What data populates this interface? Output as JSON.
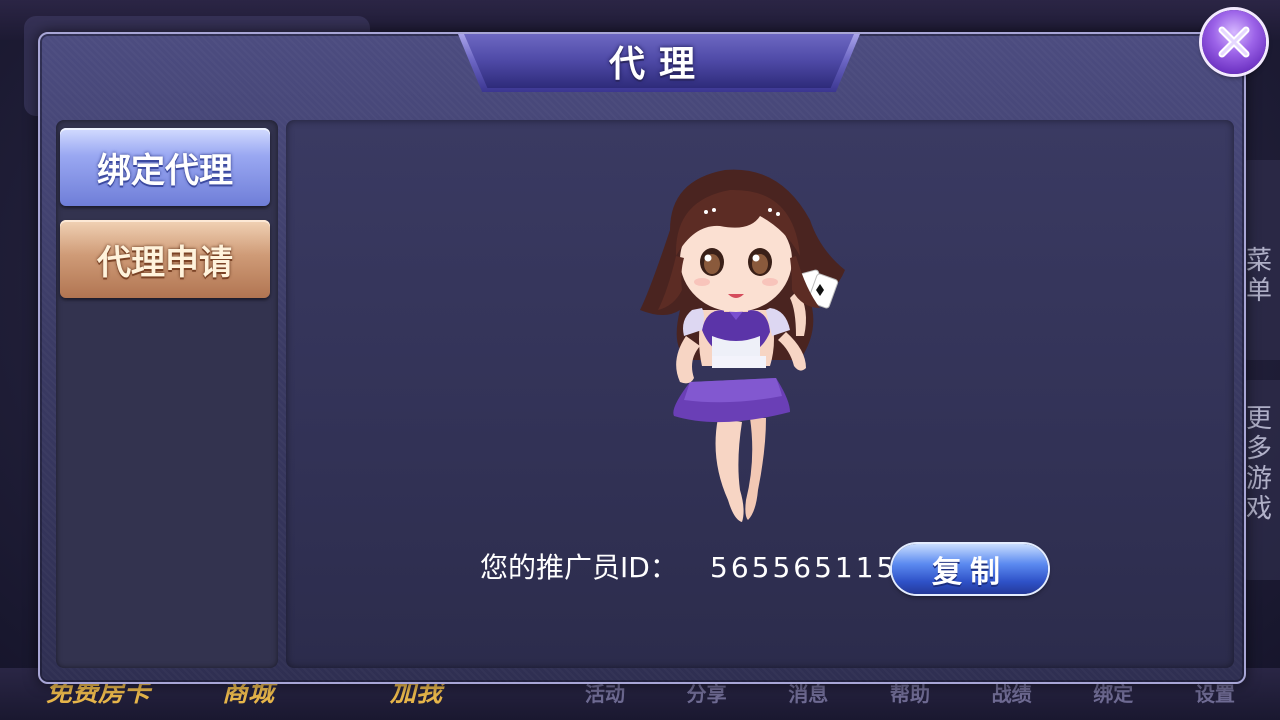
{
  "dialog": {
    "title": "代理",
    "close_icon": "close-icon"
  },
  "sidebar": {
    "items": [
      {
        "label": "绑定代理",
        "active": true
      },
      {
        "label": "代理申请",
        "active": false
      }
    ]
  },
  "content": {
    "promoter_label": "您的推广员ID：",
    "promoter_id": "565565115",
    "copy_label": "复制"
  },
  "background": {
    "promo_items": [
      "免费房卡",
      "商城",
      "加我"
    ],
    "bottom_nav": [
      "活动",
      "分享",
      "消息",
      "帮助",
      "战绩",
      "绑定",
      "设置"
    ],
    "side_tabs": [
      "菜单",
      "更多游戏"
    ]
  },
  "colors": {
    "dialog_bg": "#3a3a63",
    "active_tab": "#9aa8f2",
    "inactive_tab": "#cf9b77",
    "copy_button": "#3b63d8",
    "close_button": "#9c63e8"
  }
}
